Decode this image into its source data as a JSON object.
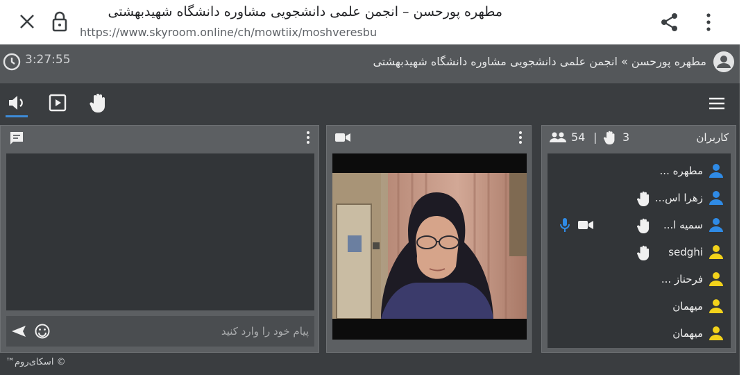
{
  "browser": {
    "page_title": "مطهره پورحسن – انجمن علمی دانشجویی مشاوره دانشگاه شهیدبهشتی",
    "url": "https://www.skyroom.online/ch/mowtiix/moshveresbu"
  },
  "room": {
    "timer": "3:27:55",
    "title": "مطهره پورحسن » انجمن علمی دانشجویی مشاوره دانشگاه شهیدبهشتی"
  },
  "toolbar": {
    "icons": [
      "speaker-icon",
      "play-icon",
      "hand-icon"
    ]
  },
  "chat": {
    "placeholder": "پیام خود را وارد کنید"
  },
  "users": {
    "label": "کاربران",
    "total": "54",
    "separator": "|",
    "hands_raised": "3",
    "list": [
      {
        "name": "مطهره ...",
        "color": "#2f8be6",
        "hand": false,
        "cam": false,
        "mic": false
      },
      {
        "name": "زهرا اس...",
        "color": "#2f8be6",
        "hand": true,
        "cam": false,
        "mic": false
      },
      {
        "name": "سمیه ا...",
        "color": "#2f8be6",
        "hand": true,
        "cam": true,
        "mic": true
      },
      {
        "name": "sedghi",
        "color": "#f2d21b",
        "hand": true,
        "cam": false,
        "mic": false
      },
      {
        "name": "فرحناز ...",
        "color": "#f2d21b",
        "hand": false,
        "cam": false,
        "mic": false
      },
      {
        "name": "میهمان",
        "color": "#f2d21b",
        "hand": false,
        "cam": false,
        "mic": false
      },
      {
        "name": "میهمان",
        "color": "#f2d21b",
        "hand": false,
        "cam": false,
        "mic": false
      }
    ]
  },
  "footer": {
    "brand": "™اسکای‌روم ©"
  },
  "colors": {
    "accent": "#3d8bd8",
    "user_blue": "#2f8be6",
    "guest_yellow": "#f2d21b"
  }
}
